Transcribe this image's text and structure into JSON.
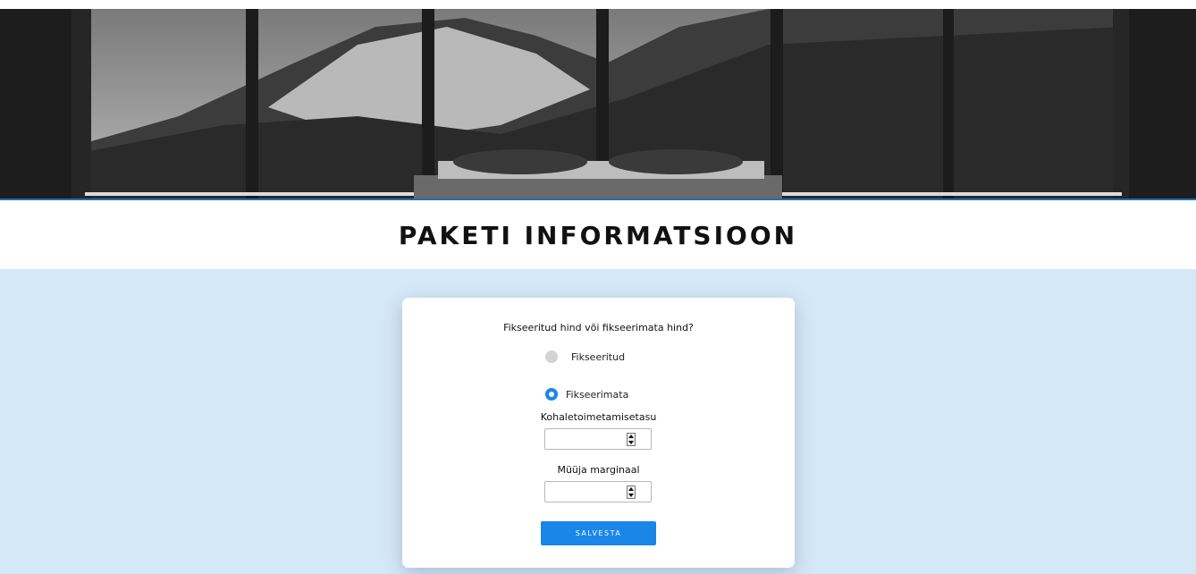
{
  "header": {
    "image_alt": "bed in front of windows overlooking forested mountains",
    "title": "PAKETI INFORMATSIOON"
  },
  "form": {
    "question": "Fikseeritud hind või fikseerimata hind?",
    "options": [
      {
        "label": "Fikseeritud",
        "selected": false
      },
      {
        "label": "Fikseerimata",
        "selected": true
      }
    ],
    "fields": [
      {
        "label": "Kohaletoimetamisetasu",
        "value": ""
      },
      {
        "label": "Müüja marginaal",
        "value": ""
      }
    ],
    "save_label": "SALVESTA"
  },
  "colors": {
    "accent": "#1a86e8",
    "page_background": "#d5e8f8",
    "card_background": "#ffffff"
  }
}
